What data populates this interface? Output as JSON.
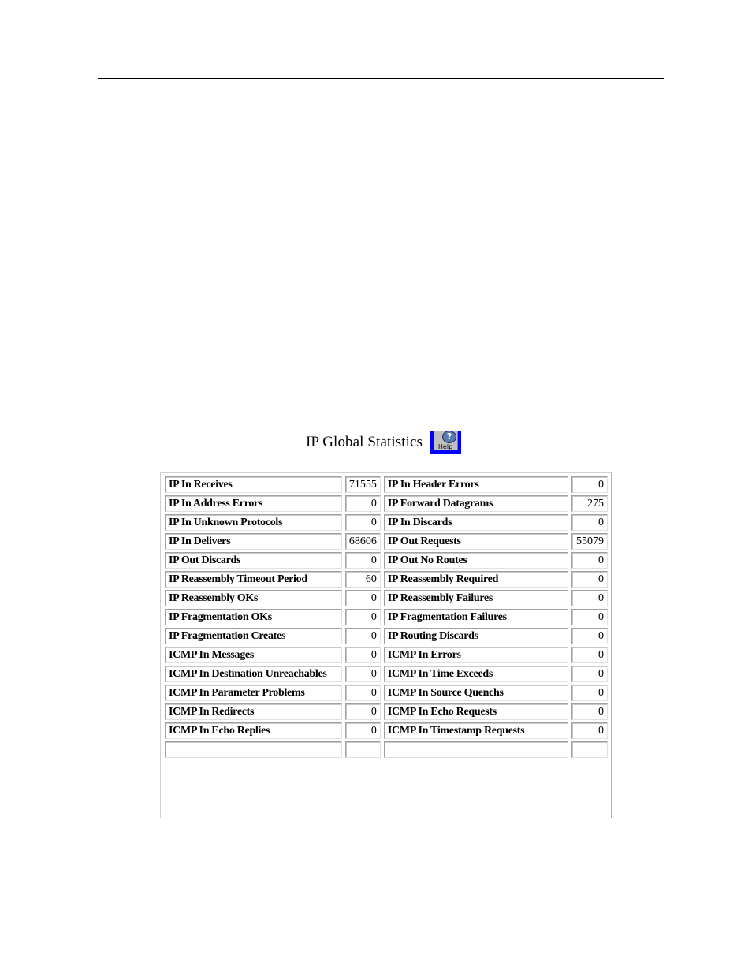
{
  "page": {
    "title": "IP Global Statistics",
    "help_button": {
      "label": "Help",
      "icon": "question-mark-icon"
    }
  },
  "stats": {
    "rows": [
      {
        "left_label": "IP In Receives",
        "left_value": "71555",
        "right_label": "IP In Header Errors",
        "right_value": "0"
      },
      {
        "left_label": "IP In Address Errors",
        "left_value": "0",
        "right_label": "IP Forward Datagrams",
        "right_value": "275"
      },
      {
        "left_label": "IP In Unknown Protocols",
        "left_value": "0",
        "right_label": "IP In Discards",
        "right_value": "0"
      },
      {
        "left_label": "IP In Delivers",
        "left_value": "68606",
        "right_label": "IP Out Requests",
        "right_value": "55079"
      },
      {
        "left_label": "IP Out Discards",
        "left_value": "0",
        "right_label": "IP Out No Routes",
        "right_value": "0"
      },
      {
        "left_label": "IP Reassembly Timeout Period",
        "left_value": "60",
        "right_label": "IP Reassembly Required",
        "right_value": "0"
      },
      {
        "left_label": "IP Reassembly OKs",
        "left_value": "0",
        "right_label": "IP Reassembly Failures",
        "right_value": "0"
      },
      {
        "left_label": "IP Fragmentation OKs",
        "left_value": "0",
        "right_label": "IP Fragmentation Failures",
        "right_value": "0"
      },
      {
        "left_label": "IP Fragmentation Creates",
        "left_value": "0",
        "right_label": "IP Routing Discards",
        "right_value": "0"
      },
      {
        "left_label": "ICMP In Messages",
        "left_value": "0",
        "right_label": "ICMP In Errors",
        "right_value": "0"
      },
      {
        "left_label": "ICMP In Destination Unreachables",
        "left_value": "0",
        "right_label": "ICMP In Time Exceeds",
        "right_value": "0"
      },
      {
        "left_label": "ICMP In Parameter Problems",
        "left_value": "0",
        "right_label": "ICMP In Source Quenchs",
        "right_value": "0"
      },
      {
        "left_label": "ICMP In Redirects",
        "left_value": "0",
        "right_label": "ICMP In Echo Requests",
        "right_value": "0"
      },
      {
        "left_label": "ICMP In Echo Replies",
        "left_value": "0",
        "right_label": "ICMP In Timestamp Requests",
        "right_value": "0"
      },
      {
        "left_label": "",
        "left_value": "",
        "right_label": "",
        "right_value": ""
      }
    ]
  }
}
